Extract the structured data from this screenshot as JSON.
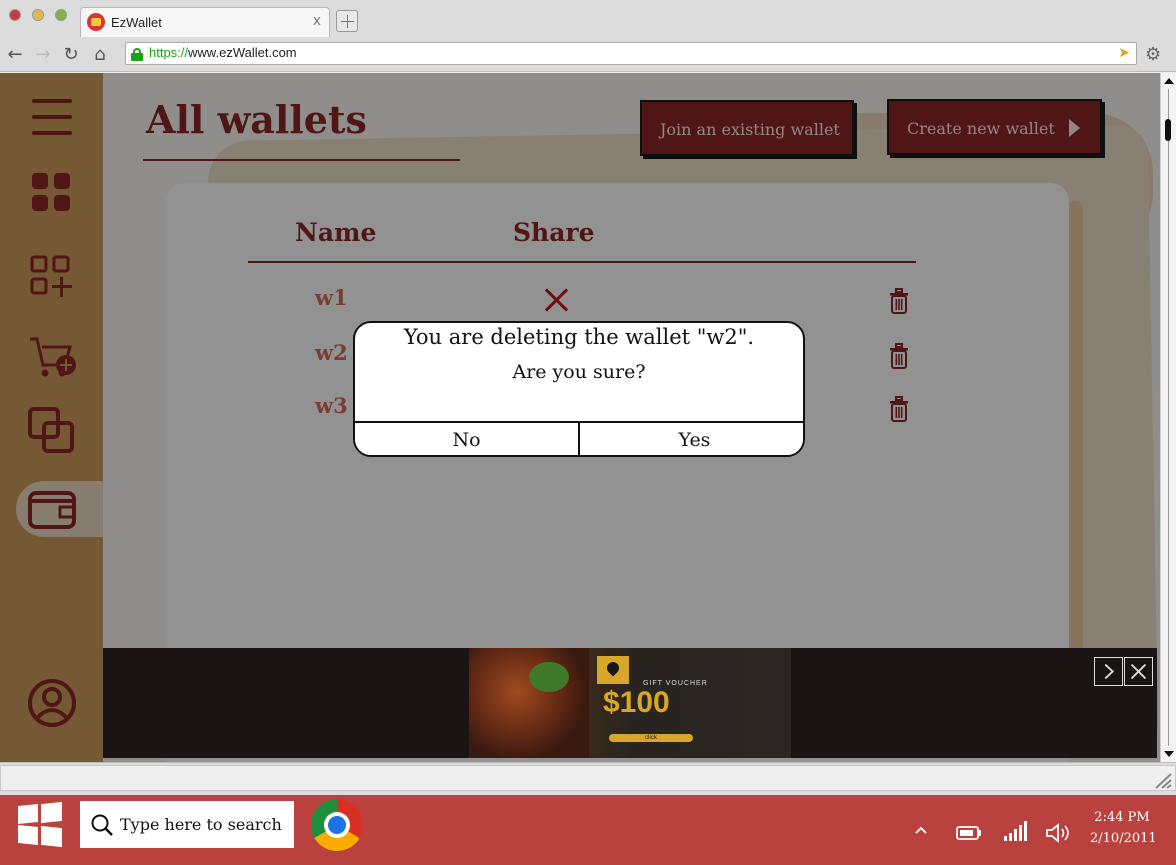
{
  "browser": {
    "tab_title": "EzWallet",
    "tab_close": "x",
    "url_protocol": "https://",
    "url_rest": "www.ezWallet.com"
  },
  "app": {
    "page_title": "All wallets",
    "join_button": "Join an existing wallet",
    "create_button": "Create new wallet",
    "table_headers": [
      "Name",
      "Share"
    ],
    "wallets": [
      {
        "name": "w1",
        "shared": false
      },
      {
        "name": "w2",
        "shared": false
      },
      {
        "name": "w3",
        "shared": false
      }
    ],
    "sidebar_icons": [
      "menu-icon",
      "dashboard-icon",
      "add-category-icon",
      "add-to-cart-icon",
      "groups-icon",
      "wallet-icon",
      "profile-icon"
    ],
    "colors": {
      "brand": "#8b2727",
      "sidebar": "#c99a5a",
      "accent": "#d06a52"
    }
  },
  "dialog": {
    "message": "You are deleting the wallet \"w2\".",
    "question": "Are you sure?",
    "no_label": "No",
    "yes_label": "Yes"
  },
  "ad": {
    "label": "GIFT VOUCHER",
    "price": "$100",
    "cta": "click"
  },
  "taskbar": {
    "search_placeholder": "Type here to search",
    "time": "2:44 PM",
    "date": "2/10/2011"
  }
}
